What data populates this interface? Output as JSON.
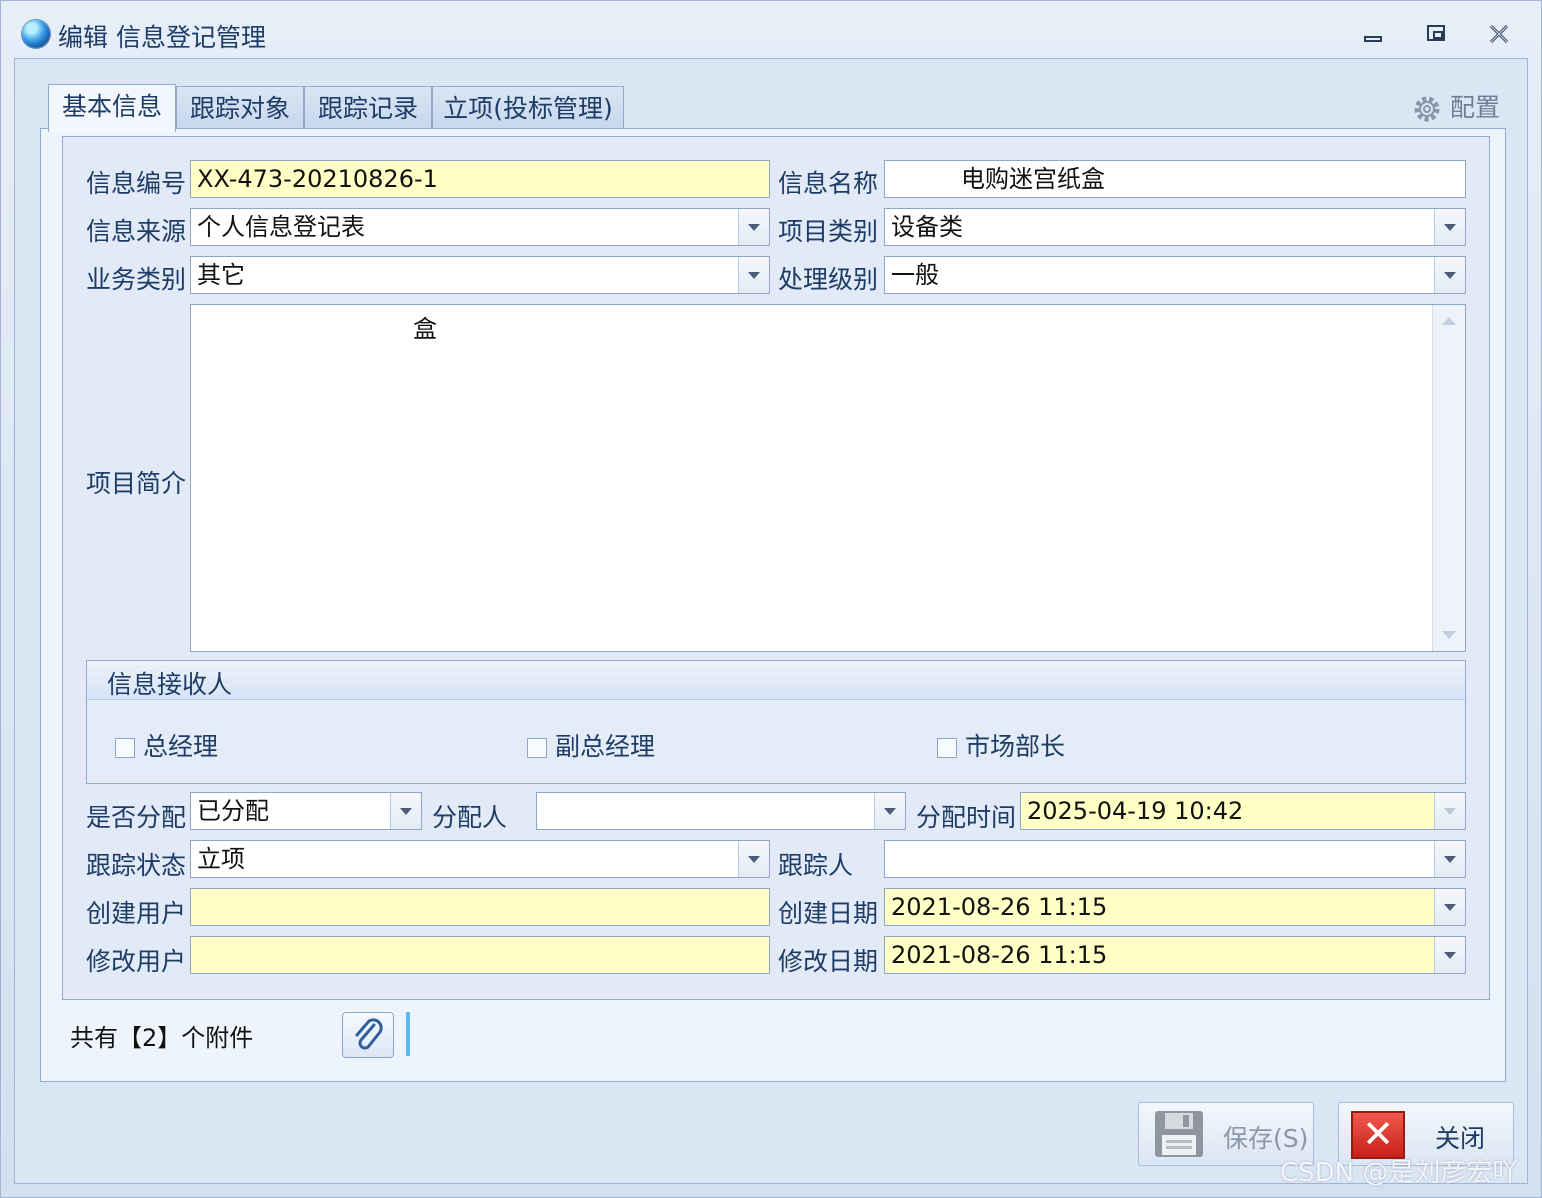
{
  "window": {
    "title": "编辑 信息登记管理"
  },
  "tabs": [
    "基本信息",
    "跟踪对象",
    "跟踪记录",
    "立项(投标管理)"
  ],
  "settings_label": "配置",
  "form": {
    "info_no": {
      "label": "信息编号",
      "value": "XX-473-20210826-1"
    },
    "info_name": {
      "label": "信息名称",
      "value": "电购迷宫纸盒"
    },
    "info_source": {
      "label": "信息来源",
      "value": "个人信息登记表"
    },
    "project_type": {
      "label": "项目类别",
      "value": "设备类"
    },
    "biz_type": {
      "label": "业务类别",
      "value": "其它"
    },
    "handle_level": {
      "label": "处理级别",
      "value": "一般"
    },
    "intro": {
      "label": "项目简介",
      "value": "盒"
    }
  },
  "receivers": {
    "title": "信息接收人",
    "items": [
      "总经理",
      "副总经理",
      "市场部长"
    ]
  },
  "assign": {
    "is_assigned": {
      "label": "是否分配",
      "value": "已分配"
    },
    "assignee": {
      "label": "分配人",
      "value": ""
    },
    "assign_time": {
      "label": "分配时间",
      "value": "2025-04-19 10:42"
    },
    "track_status": {
      "label": "跟踪状态",
      "value": "立项"
    },
    "tracker": {
      "label": "跟踪人",
      "value": ""
    },
    "creator": {
      "label": "创建用户",
      "value": ""
    },
    "create_date": {
      "label": "创建日期",
      "value": "2021-08-26 11:15"
    },
    "modifier": {
      "label": "修改用户",
      "value": ""
    },
    "modify_date": {
      "label": "修改日期",
      "value": "2021-08-26 11:15"
    }
  },
  "attachments": {
    "text": "共有【2】个附件"
  },
  "buttons": {
    "save": "保存(S)",
    "close": "关闭"
  },
  "watermark": "CSDN @是刘彦宏吖"
}
